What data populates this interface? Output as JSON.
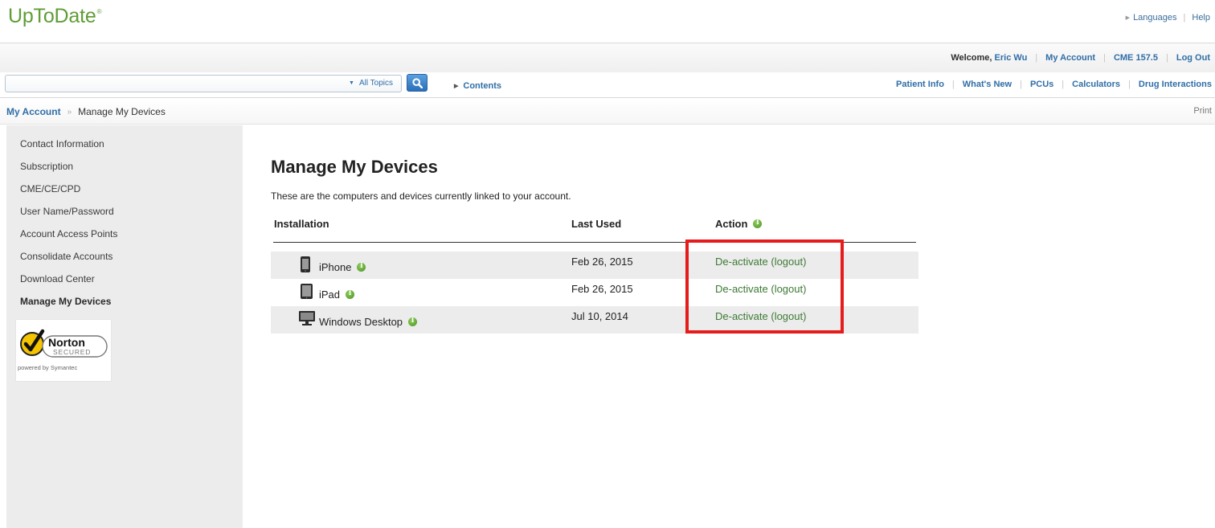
{
  "header": {
    "logo_text": "UpToDate",
    "logo_mark": "®",
    "languages_label": "Languages",
    "help_label": "Help"
  },
  "user_bar": {
    "welcome_label": "Welcome,",
    "user_name": "Eric Wu",
    "my_account_label": "My Account",
    "cme_label": "CME 157.5",
    "logout_label": "Log Out"
  },
  "search": {
    "value": "",
    "scope_label": "All Topics",
    "contents_label": "Contents"
  },
  "nav": {
    "items": [
      "Patient Info",
      "What's New",
      "PCUs",
      "Calculators",
      "Drug Interactions"
    ]
  },
  "breadcrumb": {
    "parent": "My Account",
    "current": "Manage My Devices",
    "print_label": "Print"
  },
  "sidebar": {
    "items": [
      {
        "label": "Contact Information"
      },
      {
        "label": "Subscription"
      },
      {
        "label": "CME/CE/CPD"
      },
      {
        "label": "User Name/Password"
      },
      {
        "label": "Account Access Points"
      },
      {
        "label": "Consolidate Accounts"
      },
      {
        "label": "Download Center"
      },
      {
        "label": "Manage My Devices",
        "active": true
      }
    ],
    "norton": {
      "brand": "Norton",
      "secured": "SECURED",
      "powered": "powered by Symantec"
    }
  },
  "main": {
    "title": "Manage My Devices",
    "description": "These are the computers and devices currently linked to your account.",
    "columns": {
      "installation": "Installation",
      "last_used": "Last Used",
      "action": "Action"
    },
    "devices": [
      {
        "name": "iPhone",
        "icon": "phone-icon",
        "last_used": "Feb 26, 2015",
        "action": "De-activate (logout)"
      },
      {
        "name": "iPad",
        "icon": "tablet-icon",
        "last_used": "Feb 26, 2015",
        "action": "De-activate (logout)"
      },
      {
        "name": "Windows Desktop",
        "icon": "desktop-icon",
        "last_used": "Jul 10, 2014",
        "action": "De-activate (logout)"
      }
    ]
  },
  "colors": {
    "brand_green": "#5f9d36",
    "link_blue": "#2f6ea7",
    "action_green": "#3d7a34",
    "highlight_red": "#e61b1b",
    "sidebar_bg": "#ececec"
  }
}
